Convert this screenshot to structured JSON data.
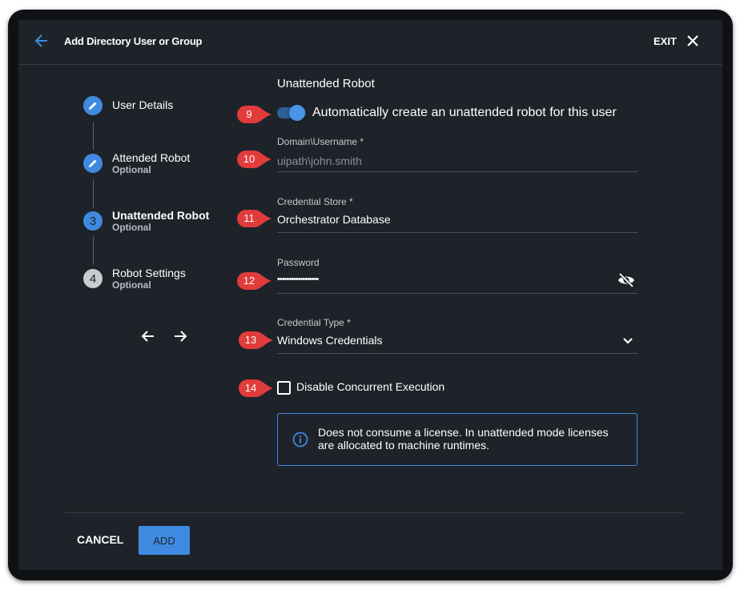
{
  "header": {
    "title": "Add Directory User or Group",
    "exit_label": "EXIT",
    "back_icon": "arrow-left-icon",
    "close_icon": "close-icon",
    "accent_color": "#3f8ae0"
  },
  "stepper": {
    "steps": [
      {
        "marker": "",
        "icon": "pencil-icon",
        "label": "User Details",
        "sub": ""
      },
      {
        "marker": "",
        "icon": "pencil-icon",
        "label": "Attended Robot",
        "sub": "Optional"
      },
      {
        "marker": "3",
        "icon": "",
        "label": "Unattended Robot",
        "sub": "Optional",
        "active": true
      },
      {
        "marker": "4",
        "icon": "",
        "label": "Robot Settings",
        "sub": "Optional"
      }
    ],
    "prev_icon": "arrow-left-icon",
    "next_icon": "arrow-right-icon"
  },
  "form": {
    "section_title": "Unattended Robot",
    "auto_create": {
      "label": "Automatically create an unattended robot for this user",
      "enabled": true
    },
    "domain_username": {
      "label": "Domain\\Username *",
      "placeholder": "uipath\\john.smith"
    },
    "credential_store": {
      "label": "Credential Store *",
      "value": "Orchestrator Database"
    },
    "password": {
      "label": "Password",
      "value": "••••••••••••••••••",
      "toggle_icon": "eye-off-icon"
    },
    "credential_type": {
      "label": "Credential Type *",
      "value": "Windows Credentials",
      "dropdown_icon": "chevron-down-icon"
    },
    "disable_concurrent": {
      "label": "Disable Concurrent Execution",
      "checked": false
    },
    "info": {
      "icon": "info-icon",
      "text": "Does not consume a license. In unattended mode licenses are allocated to machine runtimes."
    }
  },
  "footer": {
    "cancel_label": "CANCEL",
    "add_label": "ADD"
  },
  "callouts": [
    "9",
    "10",
    "11",
    "12",
    "13",
    "14"
  ],
  "callout_color": "#e23b3b"
}
